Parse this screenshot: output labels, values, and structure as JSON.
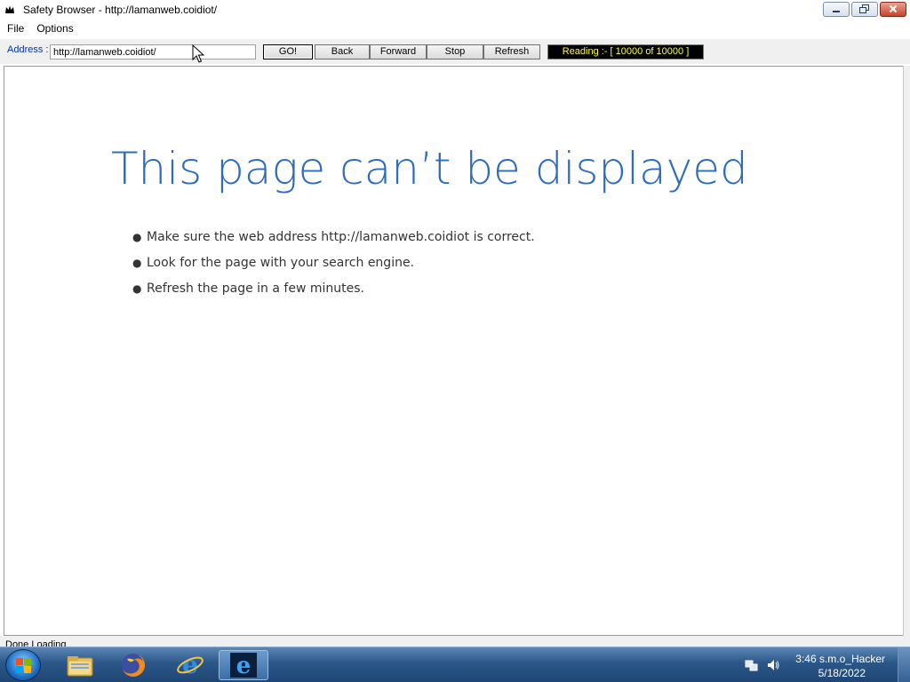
{
  "window": {
    "title": "Safety Browser - http://lamanweb.coidiot/",
    "app_icon": "crown-icon",
    "controls": {
      "minimize": "minimize-icon",
      "maximize": "restore-icon",
      "close": "close-icon"
    }
  },
  "menu": {
    "items": [
      {
        "label": "File"
      },
      {
        "label": "Options"
      }
    ]
  },
  "toolbar": {
    "address_label": "Address :",
    "address_value": "http://lamanweb.coidiot/",
    "go_label": "GO!",
    "back_label": "Back",
    "forward_label": "Forward",
    "stop_label": "Stop",
    "refresh_label": "Refresh",
    "reading_text": "Reading :- [ 10000  of  10000 ]"
  },
  "page": {
    "title": "This page can’t be displayed",
    "bullets": [
      "Make sure the web address http://lamanweb.coidiot is correct.",
      "Look for the page with your search engine.",
      "Refresh the page in a few minutes."
    ]
  },
  "status": {
    "text": "Done Loading"
  },
  "taskbar": {
    "apps": [
      {
        "name": "file-explorer-icon"
      },
      {
        "name": "firefox-icon"
      },
      {
        "name": "internet-explorer-icon"
      },
      {
        "name": "safety-browser-icon",
        "active": true
      }
    ],
    "clock_time": "3:46 s.m.o_Hacker",
    "clock_date": "5/18/2022"
  },
  "colors": {
    "title_blue": "#2e6cc0",
    "reading_text": "#ffff33",
    "taskbar": "#2b5788"
  }
}
